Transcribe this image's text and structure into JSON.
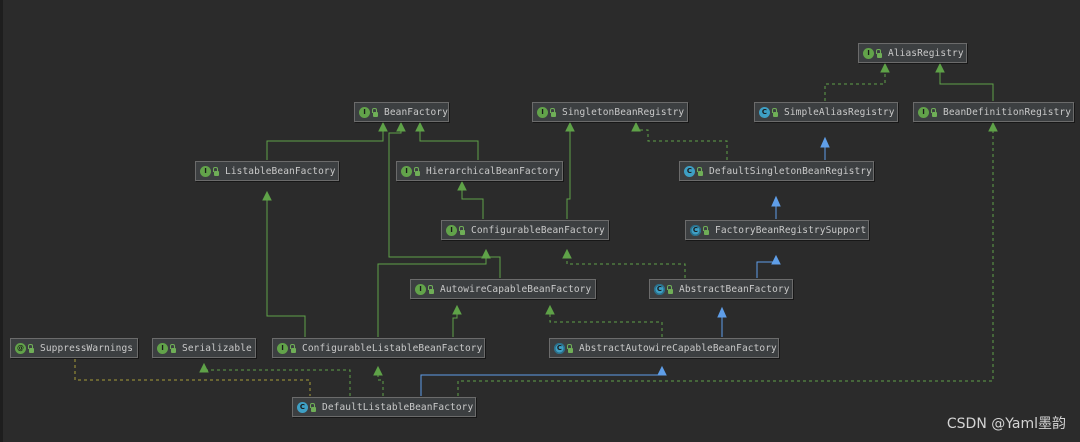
{
  "watermark": "CSDN @Yaml墨韵",
  "colors": {
    "background": "#2b2b2b",
    "node_fill": "#3c3f41",
    "extends_edge": "#5f9ee8",
    "implements_edge": "#5fa248",
    "interface_badge": "#62a34a",
    "class_badge": "#3e9fc4"
  },
  "nodes": {
    "alias_registry": {
      "label": "AliasRegistry",
      "kind": "interface",
      "badge": "I"
    },
    "bean_factory": {
      "label": "BeanFactory",
      "kind": "interface",
      "badge": "I"
    },
    "singleton_bean_registry": {
      "label": "SingletonBeanRegistry",
      "kind": "interface",
      "badge": "I"
    },
    "simple_alias_registry": {
      "label": "SimpleAliasRegistry",
      "kind": "class",
      "badge": "C"
    },
    "bean_definition_registry": {
      "label": "BeanDefinitionRegistry",
      "kind": "interface",
      "badge": "I"
    },
    "listable_bean_factory": {
      "label": "ListableBeanFactory",
      "kind": "interface",
      "badge": "I"
    },
    "hierarchical_bean_factory": {
      "label": "HierarchicalBeanFactory",
      "kind": "interface",
      "badge": "I"
    },
    "default_singleton_bean_registry": {
      "label": "DefaultSingletonBeanRegistry",
      "kind": "class",
      "badge": "C"
    },
    "configurable_bean_factory": {
      "label": "ConfigurableBeanFactory",
      "kind": "interface",
      "badge": "I"
    },
    "factory_bean_registry_support": {
      "label": "FactoryBeanRegistrySupport",
      "kind": "abstract",
      "badge": "C"
    },
    "autowire_capable_bean_factory": {
      "label": "AutowireCapableBeanFactory",
      "kind": "interface",
      "badge": "I"
    },
    "abstract_bean_factory": {
      "label": "AbstractBeanFactory",
      "kind": "abstract",
      "badge": "C"
    },
    "suppress_warnings": {
      "label": "SuppressWarnings",
      "kind": "annotation",
      "badge": "@"
    },
    "serializable": {
      "label": "Serializable",
      "kind": "interface",
      "badge": "I"
    },
    "configurable_listable_bean_factory": {
      "label": "ConfigurableListableBeanFactory",
      "kind": "interface",
      "badge": "I"
    },
    "abstract_autowire_capable_bean_factory": {
      "label": "AbstractAutowireCapableBeanFactory",
      "kind": "abstract",
      "badge": "C"
    },
    "default_listable_bean_factory": {
      "label": "DefaultListableBeanFactory",
      "kind": "class",
      "badge": "C"
    }
  }
}
